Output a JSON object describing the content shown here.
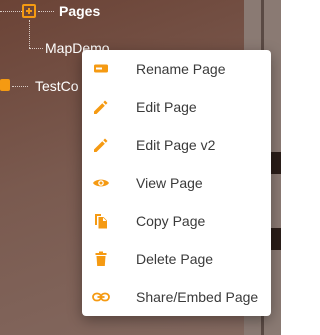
{
  "tree": {
    "pages_label": "Pages",
    "mapdemo_label": "MapDemo",
    "testco_label": "TestCo"
  },
  "menu": {
    "items": [
      {
        "label": "Rename Page",
        "icon": "rename-icon"
      },
      {
        "label": "Edit Page",
        "icon": "pencil-icon"
      },
      {
        "label": "Edit Page v2",
        "icon": "pencil-icon"
      },
      {
        "label": "View Page",
        "icon": "eye-icon"
      },
      {
        "label": "Copy Page",
        "icon": "copy-icon"
      },
      {
        "label": "Delete Page",
        "icon": "trash-icon"
      },
      {
        "label": "Share/Embed Page",
        "icon": "link-icon"
      }
    ]
  },
  "colors": {
    "accent": "#f59a12",
    "menu_text": "#3a3a3a",
    "background": "#7a5a4f"
  }
}
